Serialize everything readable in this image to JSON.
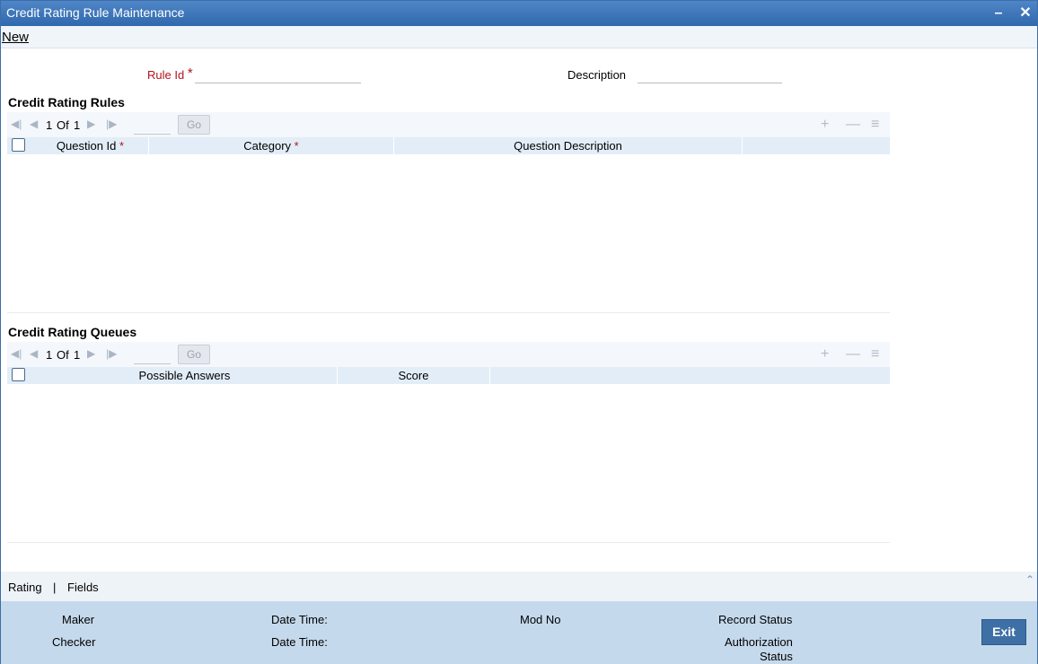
{
  "window": {
    "title": "Credit Rating Rule Maintenance"
  },
  "toolbar": {
    "new_label": "New"
  },
  "form": {
    "rule_id_label": "Rule Id",
    "required_mark": "*",
    "rule_id_value": "",
    "description_label": "Description",
    "description_value": ""
  },
  "rules_section": {
    "title": "Credit Rating Rules",
    "pager": {
      "current": "1",
      "of_label": "Of",
      "total": "1",
      "go_label": "Go"
    },
    "columns": [
      {
        "label": "Question Id",
        "required": "*"
      },
      {
        "label": "Category",
        "required": "*"
      },
      {
        "label": "Question Description",
        "required": ""
      },
      {
        "label": "",
        "required": ""
      }
    ],
    "rows": []
  },
  "queues_section": {
    "title": "Credit Rating Queues",
    "pager": {
      "current": "1",
      "of_label": "Of",
      "total": "1",
      "go_label": "Go"
    },
    "columns": [
      {
        "label": "Possible Answers"
      },
      {
        "label": "Score"
      },
      {
        "label": ""
      }
    ],
    "rows": []
  },
  "bottom_tabs": {
    "rating": "Rating",
    "separator": "|",
    "fields": "Fields"
  },
  "footer": {
    "maker": "Maker",
    "checker": "Checker",
    "date_time_1": "Date Time:",
    "date_time_2": "Date Time:",
    "mod_no": "Mod No",
    "record_status": "Record Status",
    "authorization": "Authorization",
    "status": "Status",
    "exit_label": "Exit"
  },
  "icons": {
    "minimize": "minimize-icon",
    "close": "close-icon",
    "first_page": "first-page-icon",
    "prev_page": "prev-page-icon",
    "next_page": "next-page-icon",
    "last_page": "last-page-icon",
    "add_row": "add-row-icon",
    "delete_row": "delete-row-icon",
    "single_view": "single-view-icon",
    "collapse": "collapse-up-icon"
  },
  "colors": {
    "title_bar": "#2f68ad",
    "required": "#b5121b",
    "footer_bg": "#c5d9ec",
    "exit_button": "#3e70a6"
  }
}
